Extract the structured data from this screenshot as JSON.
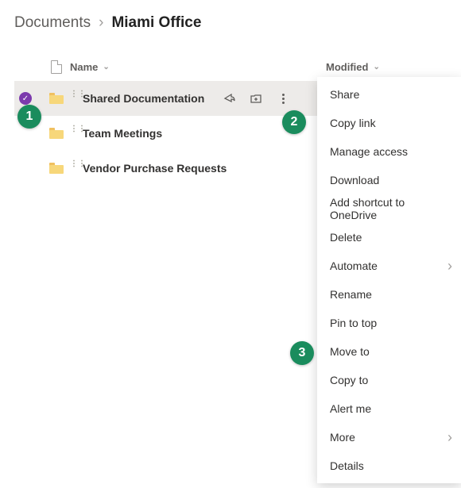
{
  "breadcrumb": {
    "parent": "Documents",
    "current": "Miami Office"
  },
  "columns": {
    "name": "Name",
    "modified": "Modified"
  },
  "rows": [
    {
      "label": "Shared Documentation",
      "selected": true
    },
    {
      "label": "Team Meetings",
      "selected": false
    },
    {
      "label": "Vendor Purchase Requests",
      "selected": false
    }
  ],
  "menu": [
    {
      "label": "Share"
    },
    {
      "label": "Copy link"
    },
    {
      "label": "Manage access"
    },
    {
      "label": "Download"
    },
    {
      "label": "Add shortcut to OneDrive"
    },
    {
      "label": "Delete"
    },
    {
      "label": "Automate",
      "sub": true
    },
    {
      "label": "Rename"
    },
    {
      "label": "Pin to top"
    },
    {
      "label": "Move to"
    },
    {
      "label": "Copy to"
    },
    {
      "label": "Alert me"
    },
    {
      "label": "More",
      "sub": true
    },
    {
      "label": "Details"
    }
  ],
  "badges": {
    "b1": "1",
    "b2": "2",
    "b3": "3"
  }
}
